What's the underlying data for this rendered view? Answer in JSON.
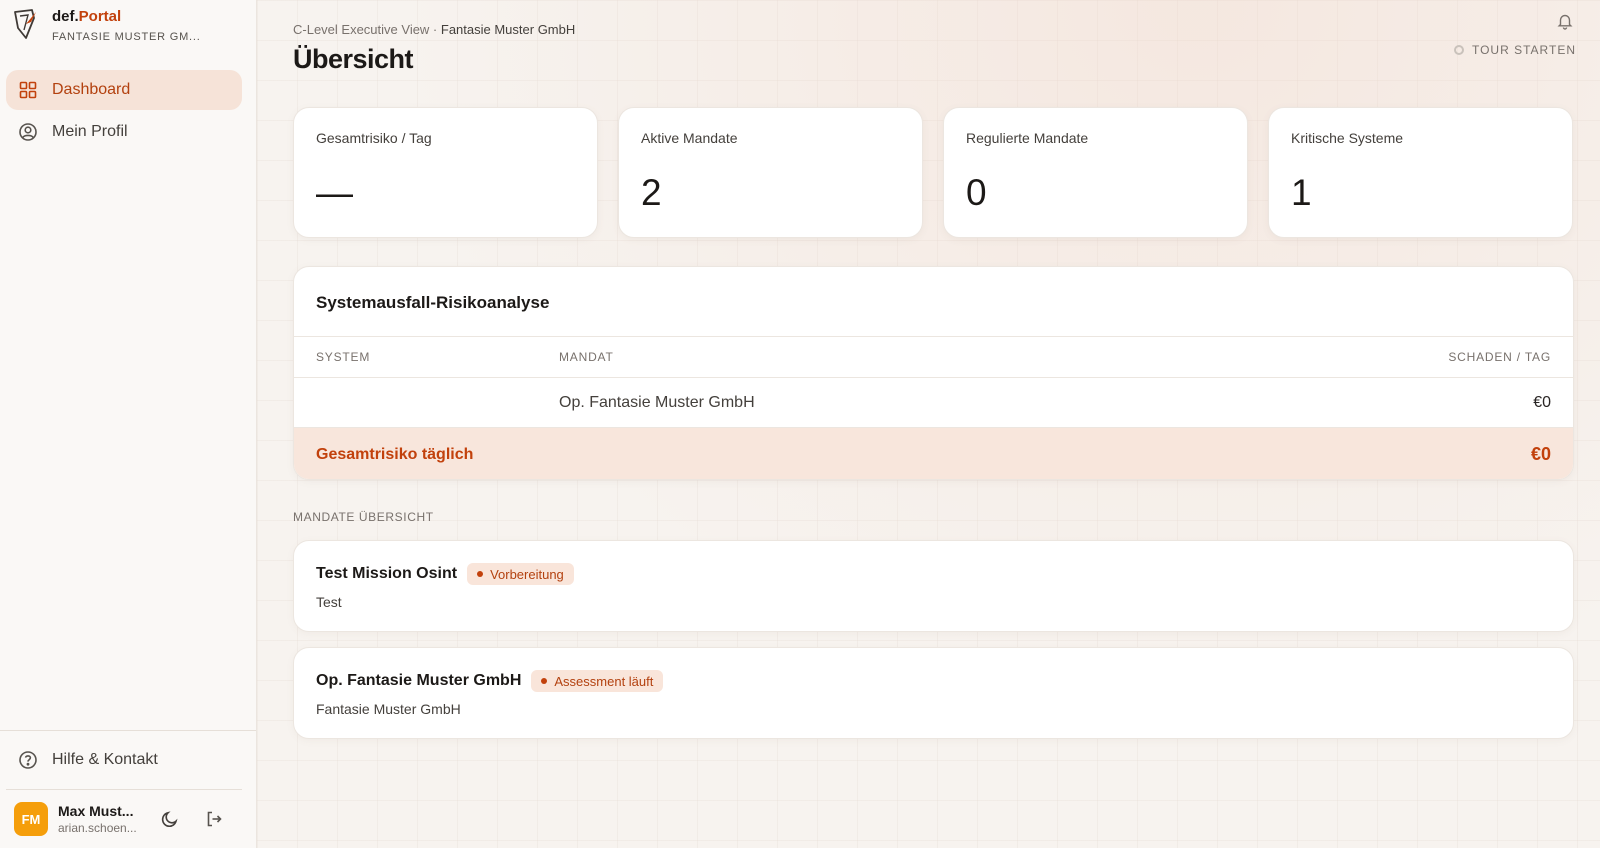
{
  "brand": {
    "name_prefix": "def.",
    "name_suffix": "Portal",
    "org": "FANTASIE MUSTER GM..."
  },
  "nav": {
    "items": [
      {
        "label": "Dashboard",
        "icon": "grid-icon",
        "active": true
      },
      {
        "label": "Mein Profil",
        "icon": "user-circle-icon",
        "active": false
      }
    ]
  },
  "sidebar_bottom": {
    "help_label": "Hilfe & Kontakt",
    "user": {
      "initials": "FM",
      "name": "Max Must...",
      "email": "arian.schoen..."
    }
  },
  "header": {
    "breadcrumb_view": "C-Level Executive View · ",
    "breadcrumb_org": "Fantasie Muster GmbH",
    "title": "Übersicht",
    "tour_label": "TOUR STARTEN"
  },
  "stats": [
    {
      "label": "Gesamtrisiko / Tag",
      "value": "—"
    },
    {
      "label": "Aktive Mandate",
      "value": "2"
    },
    {
      "label": "Regulierte Mandate",
      "value": "0"
    },
    {
      "label": "Kritische Systeme",
      "value": "1"
    }
  ],
  "risk": {
    "title": "Systemausfall-Risikoanalyse",
    "columns": {
      "system": "SYSTEM",
      "mandate": "MANDAT",
      "damage": "SCHADEN / TAG"
    },
    "rows": [
      {
        "system": "",
        "mandate": "Op. Fantasie Muster GmbH",
        "damage": "€0"
      }
    ],
    "total_label": "Gesamtrisiko täglich",
    "total_value": "€0"
  },
  "mandates": {
    "section_label": "MANDATE ÜBERSICHT",
    "items": [
      {
        "title": "Test Mission Osint",
        "status": "Vorbereitung",
        "subtitle": "Test"
      },
      {
        "title": "Op. Fantasie Muster GmbH",
        "status": "Assessment läuft",
        "subtitle": "Fantasie Muster GmbH"
      }
    ]
  },
  "colors": {
    "accent": "#c2410c",
    "accent_bg": "#f6e3d8",
    "avatar": "#f59e0b"
  }
}
